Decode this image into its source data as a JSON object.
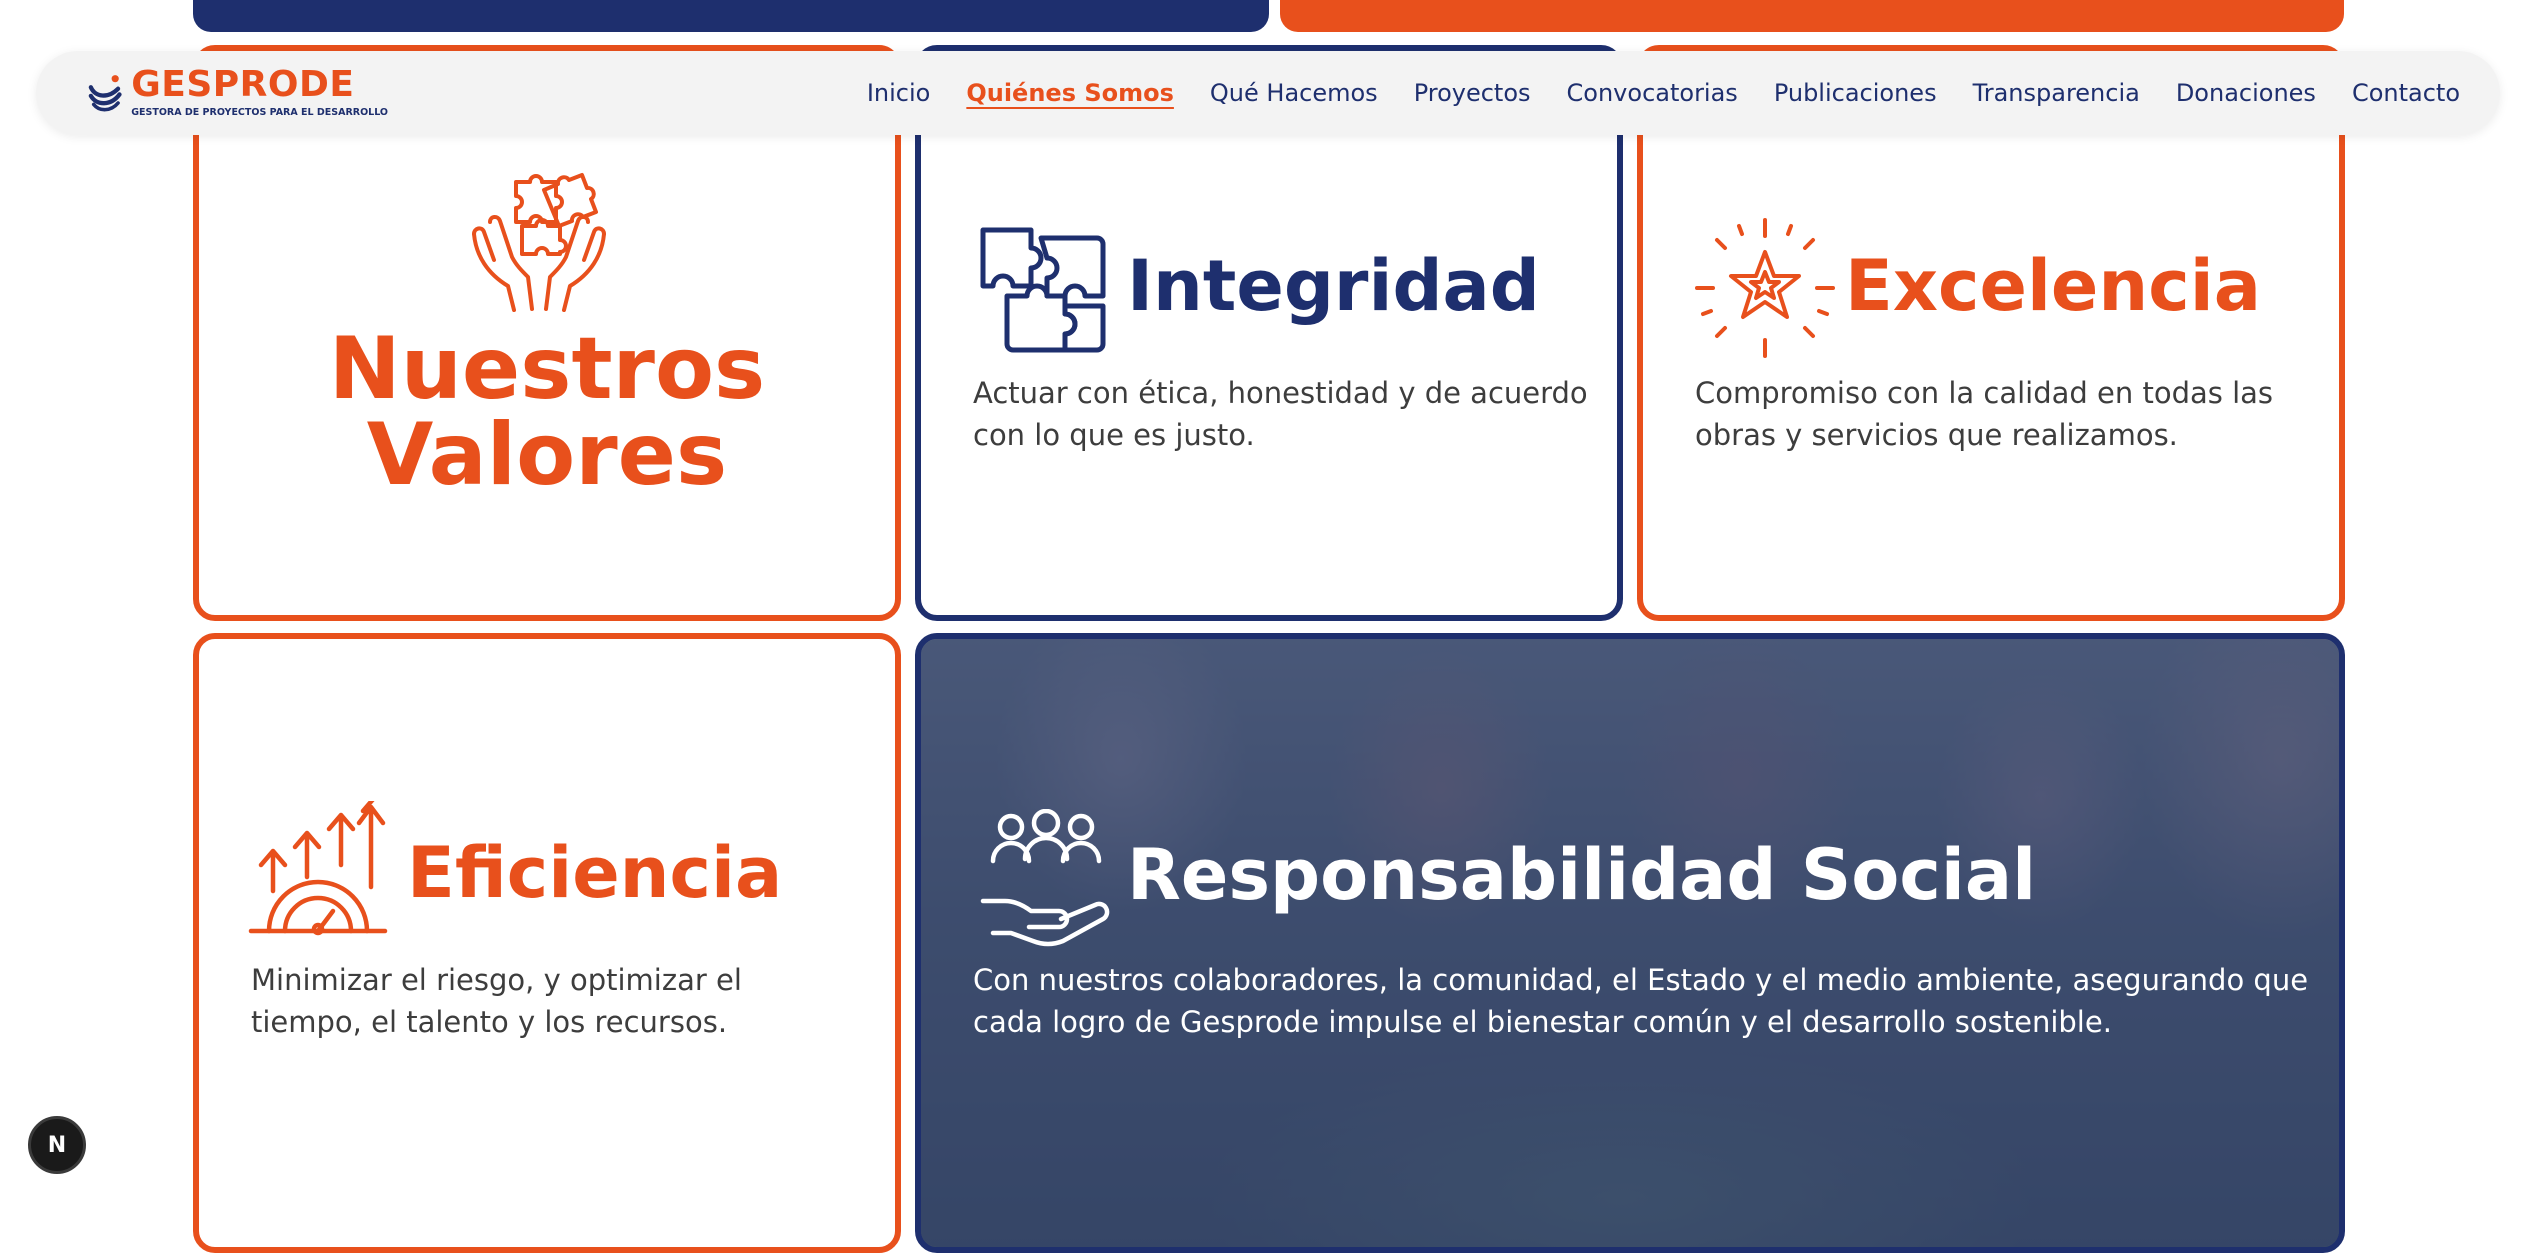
{
  "brand": {
    "name": "GESPRODE",
    "tagline": "GESTORA DE PROYECTOS PARA EL DESARROLLO",
    "primary_color": "#e8501c",
    "secondary_color": "#1e2f6e"
  },
  "nav": {
    "items": [
      {
        "label": "Inicio",
        "active": false
      },
      {
        "label": "Quiénes Somos",
        "active": true
      },
      {
        "label": "Qué Hacemos",
        "active": false
      },
      {
        "label": "Proyectos",
        "active": false
      },
      {
        "label": "Convocatorias",
        "active": false
      },
      {
        "label": "Publicaciones",
        "active": false
      },
      {
        "label": "Transparencia",
        "active": false
      },
      {
        "label": "Donaciones",
        "active": false
      },
      {
        "label": "Contacto",
        "active": false
      }
    ]
  },
  "values_section": {
    "title_line1": "Nuestros",
    "title_line2": "Valores",
    "title_icon": "hands-puzzle-icon",
    "cards": [
      {
        "title": "Integridad",
        "icon": "puzzle-icon",
        "description": "Actuar con ética, honestidad y de acuerdo con lo que es justo."
      },
      {
        "title": "Excelencia",
        "icon": "star-burst-icon",
        "description": "Compromiso con la calidad en todas las obras y servicios que realizamos."
      },
      {
        "title": "Eficiencia",
        "icon": "growth-gauge-icon",
        "description": "Minimizar el riesgo, y optimizar el tiempo, el talento y los recursos."
      },
      {
        "title": "Responsabilidad Social",
        "icon": "community-hand-icon",
        "description": "Con nuestros colaboradores, la comunidad, el Estado y el medio ambiente, asegurando que cada logro de Gesprode impulse el bienestar común y el desarrollo sostenible."
      }
    ]
  },
  "dev_badge": {
    "label": "N"
  }
}
